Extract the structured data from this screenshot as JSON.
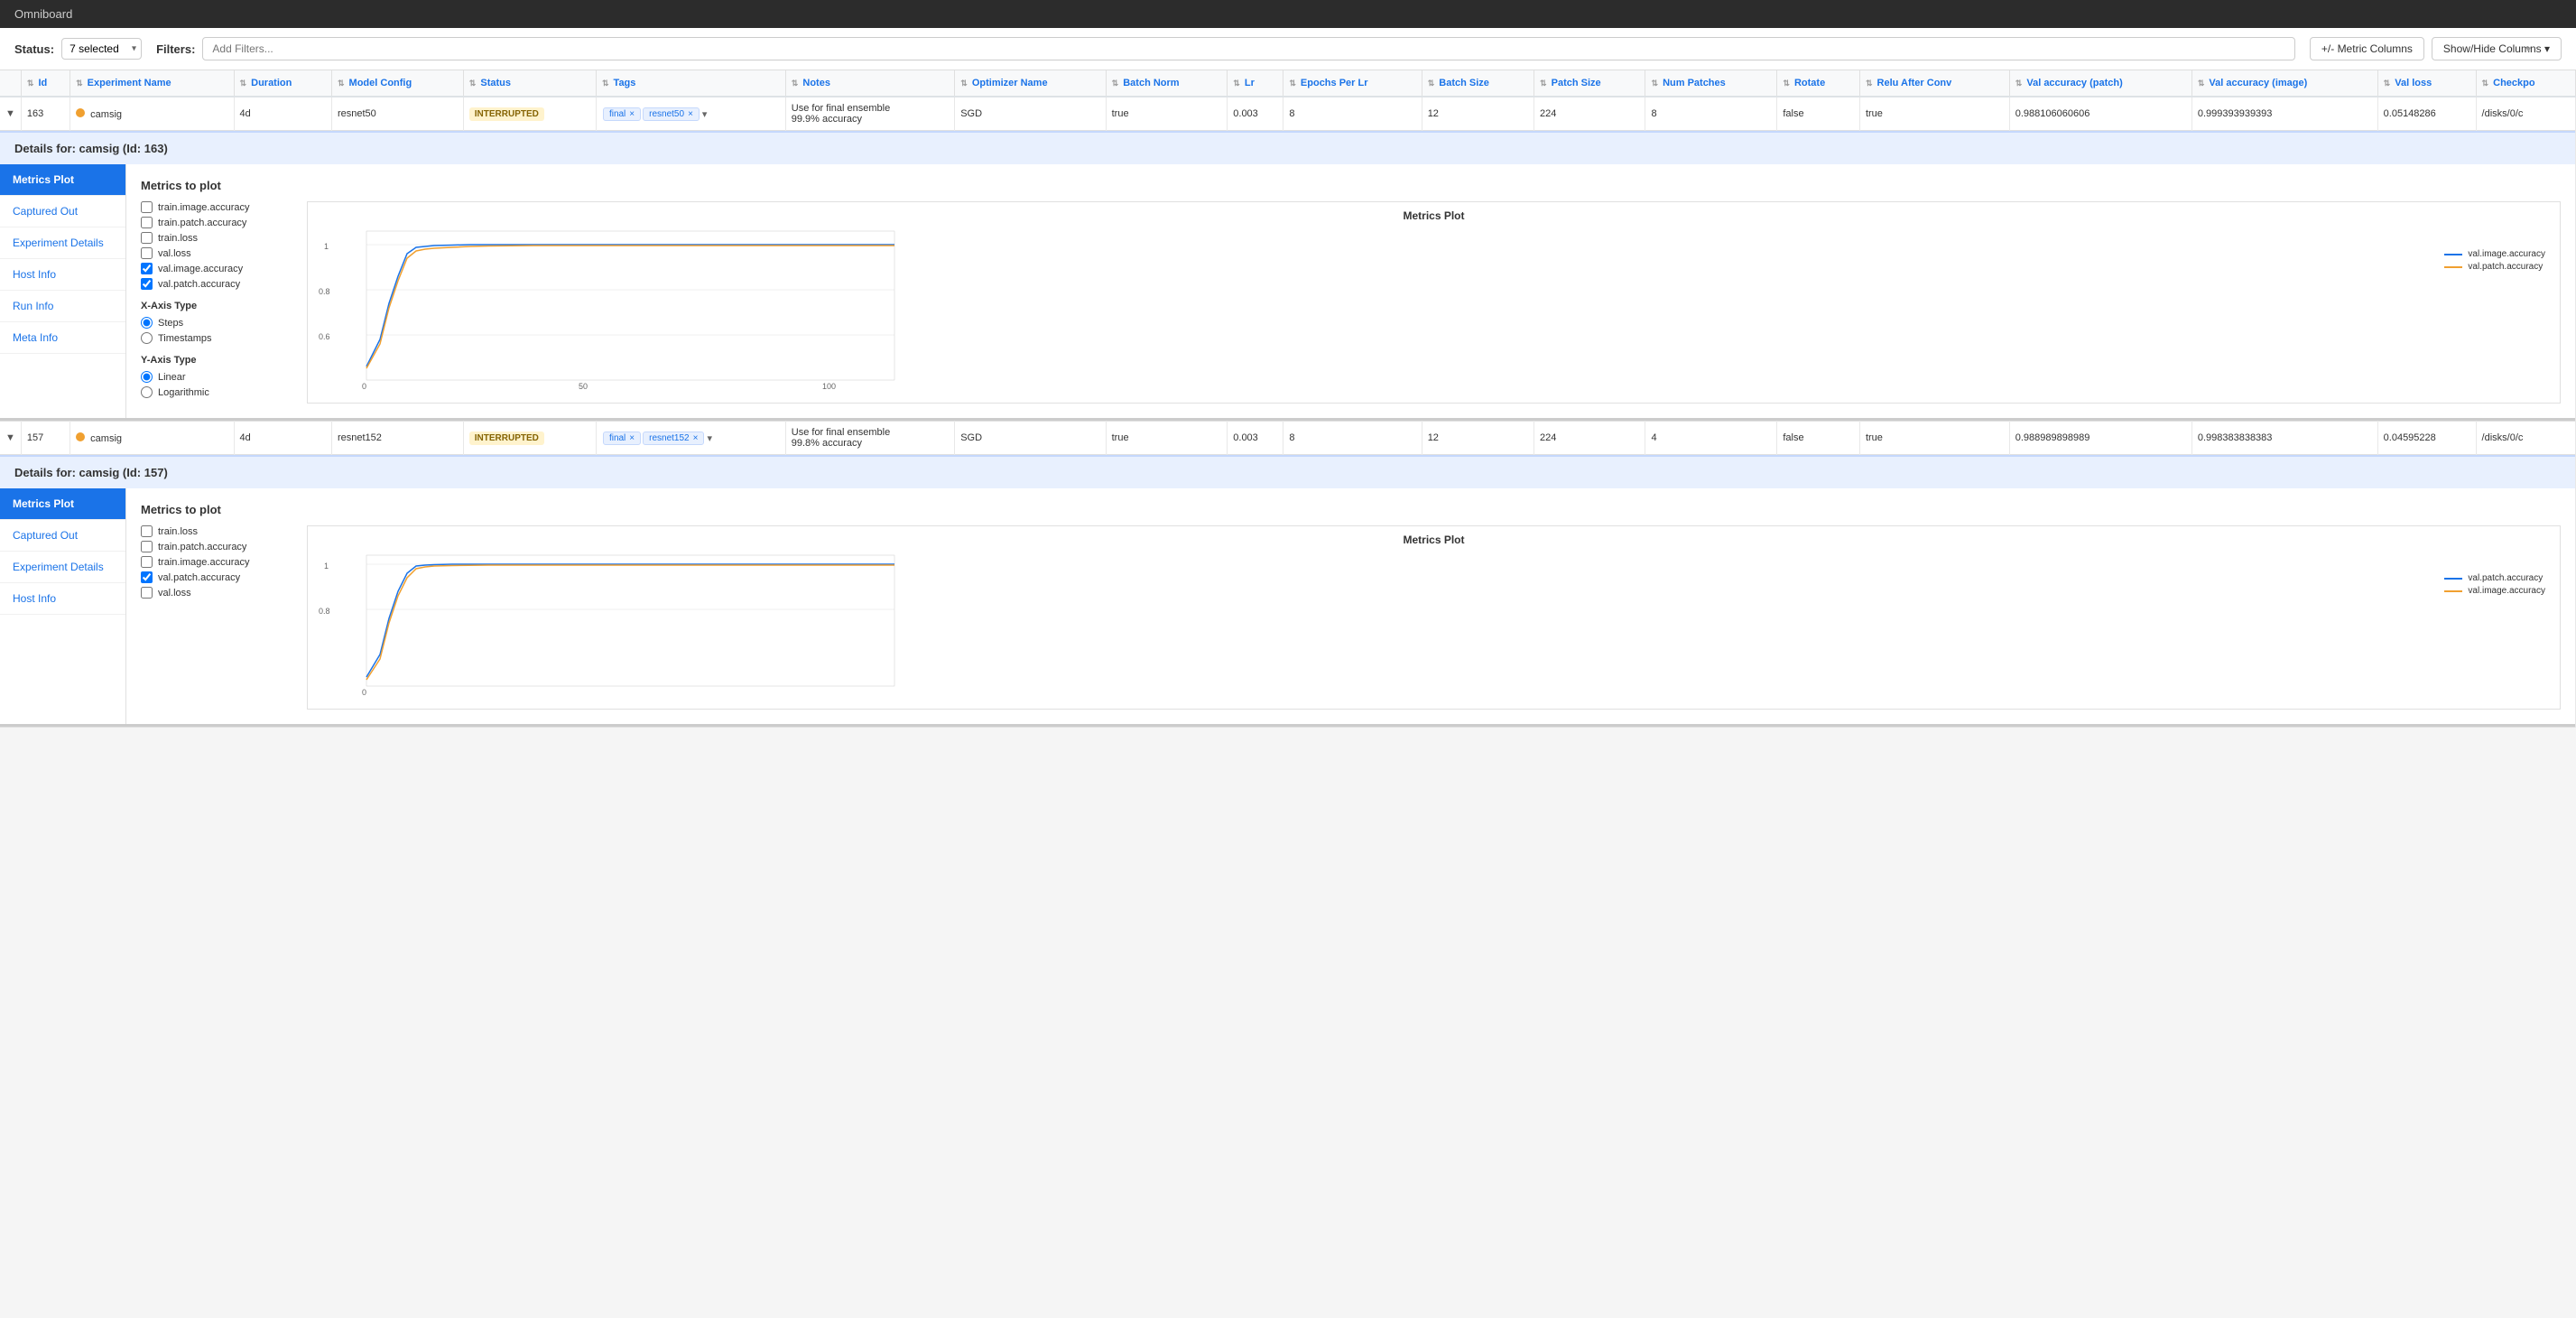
{
  "app": {
    "title": "Omniboard"
  },
  "toolbar": {
    "status_label": "Status:",
    "selected_text": "7 selected",
    "filters_label": "Filters:",
    "filters_placeholder": "Add Filters...",
    "metric_columns_btn": "+/- Metric Columns",
    "show_hide_btn": "Show/Hide Columns ▾"
  },
  "table": {
    "columns": [
      {
        "key": "id",
        "label": "Id"
      },
      {
        "key": "exp_name",
        "label": "Experiment Name"
      },
      {
        "key": "duration",
        "label": "Duration"
      },
      {
        "key": "model_config",
        "label": "Model Config"
      },
      {
        "key": "status",
        "label": "Status"
      },
      {
        "key": "tags",
        "label": "Tags"
      },
      {
        "key": "notes",
        "label": "Notes"
      },
      {
        "key": "optimizer",
        "label": "Optimizer Name"
      },
      {
        "key": "batch_norm",
        "label": "Batch Norm"
      },
      {
        "key": "lr",
        "label": "Lr"
      },
      {
        "key": "epochs_per_lr",
        "label": "Epochs Per Lr"
      },
      {
        "key": "batch_size",
        "label": "Batch Size"
      },
      {
        "key": "patch_size",
        "label": "Patch Size"
      },
      {
        "key": "num_patches",
        "label": "Num Patches"
      },
      {
        "key": "rotate",
        "label": "Rotate"
      },
      {
        "key": "relu_after_conv",
        "label": "Relu After Conv"
      },
      {
        "key": "val_acc_patch",
        "label": "Val accuracy (patch)"
      },
      {
        "key": "val_acc_image",
        "label": "Val accuracy (image)"
      },
      {
        "key": "val_loss",
        "label": "Val loss"
      },
      {
        "key": "checkpoint",
        "label": "Checkpo"
      }
    ],
    "rows": [
      {
        "id": "163",
        "exp_name": "camsig",
        "duration": "4d",
        "model_config": "resnet50",
        "status": "INTERRUPTED",
        "tags": [
          "final",
          "resnet50"
        ],
        "notes": "Use for final ensemble\n99.9% accuracy",
        "optimizer": "SGD",
        "batch_norm": "true",
        "lr": "0.003",
        "epochs_per_lr": "8",
        "batch_size": "12",
        "patch_size": "224",
        "num_patches": "8",
        "rotate": "false",
        "relu_after_conv": "true",
        "val_acc_patch": "0.988106060606",
        "val_acc_image": "0.999393939393",
        "val_loss": "0.05148286",
        "checkpoint": "/disks/0/c",
        "dot_color": "orange"
      },
      {
        "id": "157",
        "exp_name": "camsig",
        "duration": "4d",
        "model_config": "resnet152",
        "status": "INTERRUPTED",
        "tags": [
          "final",
          "resnet152"
        ],
        "notes": "Use for final ensemble\n99.8% accuracy",
        "optimizer": "SGD",
        "batch_norm": "true",
        "lr": "0.003",
        "epochs_per_lr": "8",
        "batch_size": "12",
        "patch_size": "224",
        "num_patches": "4",
        "rotate": "false",
        "relu_after_conv": "true",
        "val_acc_patch": "0.988989898989",
        "val_acc_image": "0.998383838383",
        "val_loss": "0.04595228",
        "checkpoint": "/disks/0/c",
        "dot_color": "orange"
      }
    ]
  },
  "details": [
    {
      "id": "163",
      "name": "camsig",
      "sidebar": [
        {
          "label": "Metrics Plot",
          "active": true
        },
        {
          "label": "Captured Out",
          "active": false
        },
        {
          "label": "Experiment Details",
          "active": false
        },
        {
          "label": "Host Info",
          "active": false
        },
        {
          "label": "Run Info",
          "active": false
        },
        {
          "label": "Meta Info",
          "active": false
        }
      ],
      "metrics": {
        "title": "Metrics to plot",
        "checkboxes": [
          {
            "label": "train.image.accuracy",
            "checked": false
          },
          {
            "label": "train.patch.accuracy",
            "checked": false
          },
          {
            "label": "train.loss",
            "checked": false
          },
          {
            "label": "val.loss",
            "checked": false
          },
          {
            "label": "val.image.accuracy",
            "checked": true
          },
          {
            "label": "val.patch.accuracy",
            "checked": true
          }
        ],
        "x_axis": {
          "title": "X-Axis Type",
          "options": [
            {
              "label": "Steps",
              "selected": true
            },
            {
              "label": "Timestamps",
              "selected": false
            }
          ]
        },
        "y_axis": {
          "title": "Y-Axis Type",
          "options": [
            {
              "label": "Linear",
              "selected": true
            },
            {
              "label": "Logarithmic",
              "selected": false
            }
          ]
        }
      },
      "chart_title": "Metrics Plot",
      "legend": [
        {
          "label": "val.image.accuracy",
          "color": "#1a73e8"
        },
        {
          "label": "val.patch.accuracy",
          "color": "#f0a030"
        }
      ]
    },
    {
      "id": "157",
      "name": "camsig",
      "sidebar": [
        {
          "label": "Metrics Plot",
          "active": true
        },
        {
          "label": "Captured Out",
          "active": false
        },
        {
          "label": "Experiment Details",
          "active": false
        },
        {
          "label": "Host Info",
          "active": false
        }
      ],
      "metrics": {
        "title": "Metrics to plot",
        "checkboxes": [
          {
            "label": "train.loss",
            "checked": false
          },
          {
            "label": "train.patch.accuracy",
            "checked": false
          },
          {
            "label": "train.image.accuracy",
            "checked": false
          },
          {
            "label": "val.patch.accuracy",
            "checked": true
          },
          {
            "label": "val.loss",
            "checked": false
          }
        ],
        "x_axis": null,
        "y_axis": null
      },
      "chart_title": "Metrics Plot",
      "legend": [
        {
          "label": "val.patch.accuracy",
          "color": "#1a73e8"
        },
        {
          "label": "val.image.accuracy",
          "color": "#f0a030"
        }
      ]
    }
  ],
  "captured_out_label": "Captured Out",
  "train_patch_accuracy_label": "train patch accuracy"
}
